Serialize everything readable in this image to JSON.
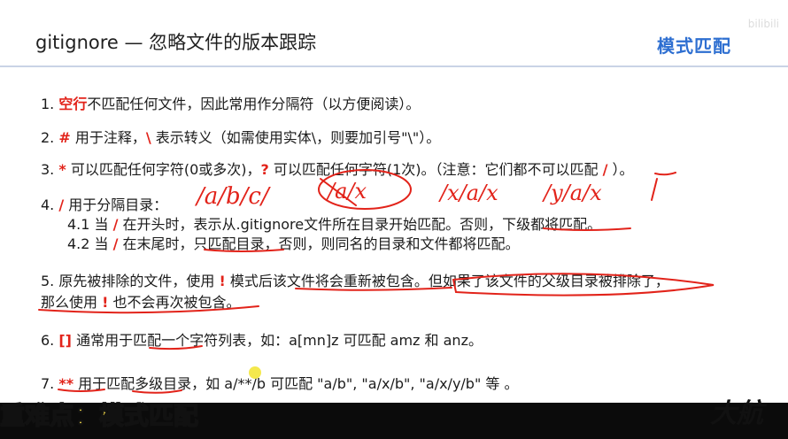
{
  "header": {
    "title": "gitignore — 忽略文件的版本跟踪",
    "tag": "模式匹配",
    "watermark": "bilibili"
  },
  "rules": {
    "r1": {
      "num": "1. ",
      "key": "空行",
      "rest": "不匹配任何文件，因此常用作分隔符（以方便阅读）。"
    },
    "r2": {
      "num": "2. ",
      "key": "#",
      "mid": " 用于注释，",
      "key2": "\\",
      "rest": " 表示转义（如需使用实体\\，则要加引号\"\\\"）。"
    },
    "r3": {
      "num": "3. ",
      "key": "*",
      "mid": " 可以匹配任何字符(0或多次)，",
      "key2": "?",
      "rest": " 可以匹配任何字符(1次)。（注意：它们都不可以匹配 ",
      "key3": "/",
      "end": " ）。"
    },
    "r4": {
      "num": "4. ",
      "key": "/",
      "rest": " 用于分隔目录：",
      "s1_pre": "4.1 当 ",
      "s1_key": "/",
      "s1_rest": " 在开头时，表示从.gitignore文件所在目录开始匹配。否则，下级都将匹配。",
      "s2_pre": "4.2 当 ",
      "s2_key": "/",
      "s2_rest": " 在末尾时，只匹配目录，否则，则同名的目录和文件都将匹配。"
    },
    "r5": {
      "num": "5. ",
      "pre": "原先被排除的文件，使用 ",
      "key": "!",
      "rest": " 模式后该文件将会重新被包含。但如果了该文件的父级目录被排除了，",
      "line2_pre": "那么使用 ",
      "line2_key": "!",
      "line2_rest": " 也不会再次被包含。"
    },
    "r6": {
      "num": "6. ",
      "key": "[]",
      "rest": " 通常用于匹配一个字符列表，如：a[mn]z 可匹配 amz 和 anz。"
    },
    "r7": {
      "num": "7. ",
      "key": "**",
      "rest": " 用于匹配多级目录，如 a/**/b 可匹配 \"a/b\", \"a/x/b\", \"a/x/y/b\" 等 。"
    }
  },
  "handwriting": {
    "h1": "/a/b/c/",
    "h2": "/a/x",
    "h3": "/x/a/x",
    "h4": "/y/a/x"
  },
  "footer": {
    "caption": "重难点：模式匹配",
    "logo": "大航"
  },
  "colors": {
    "accent_red": "#e2231a",
    "tag_blue": "#2e6fd1",
    "caption_yellow": "#ffe44a"
  }
}
